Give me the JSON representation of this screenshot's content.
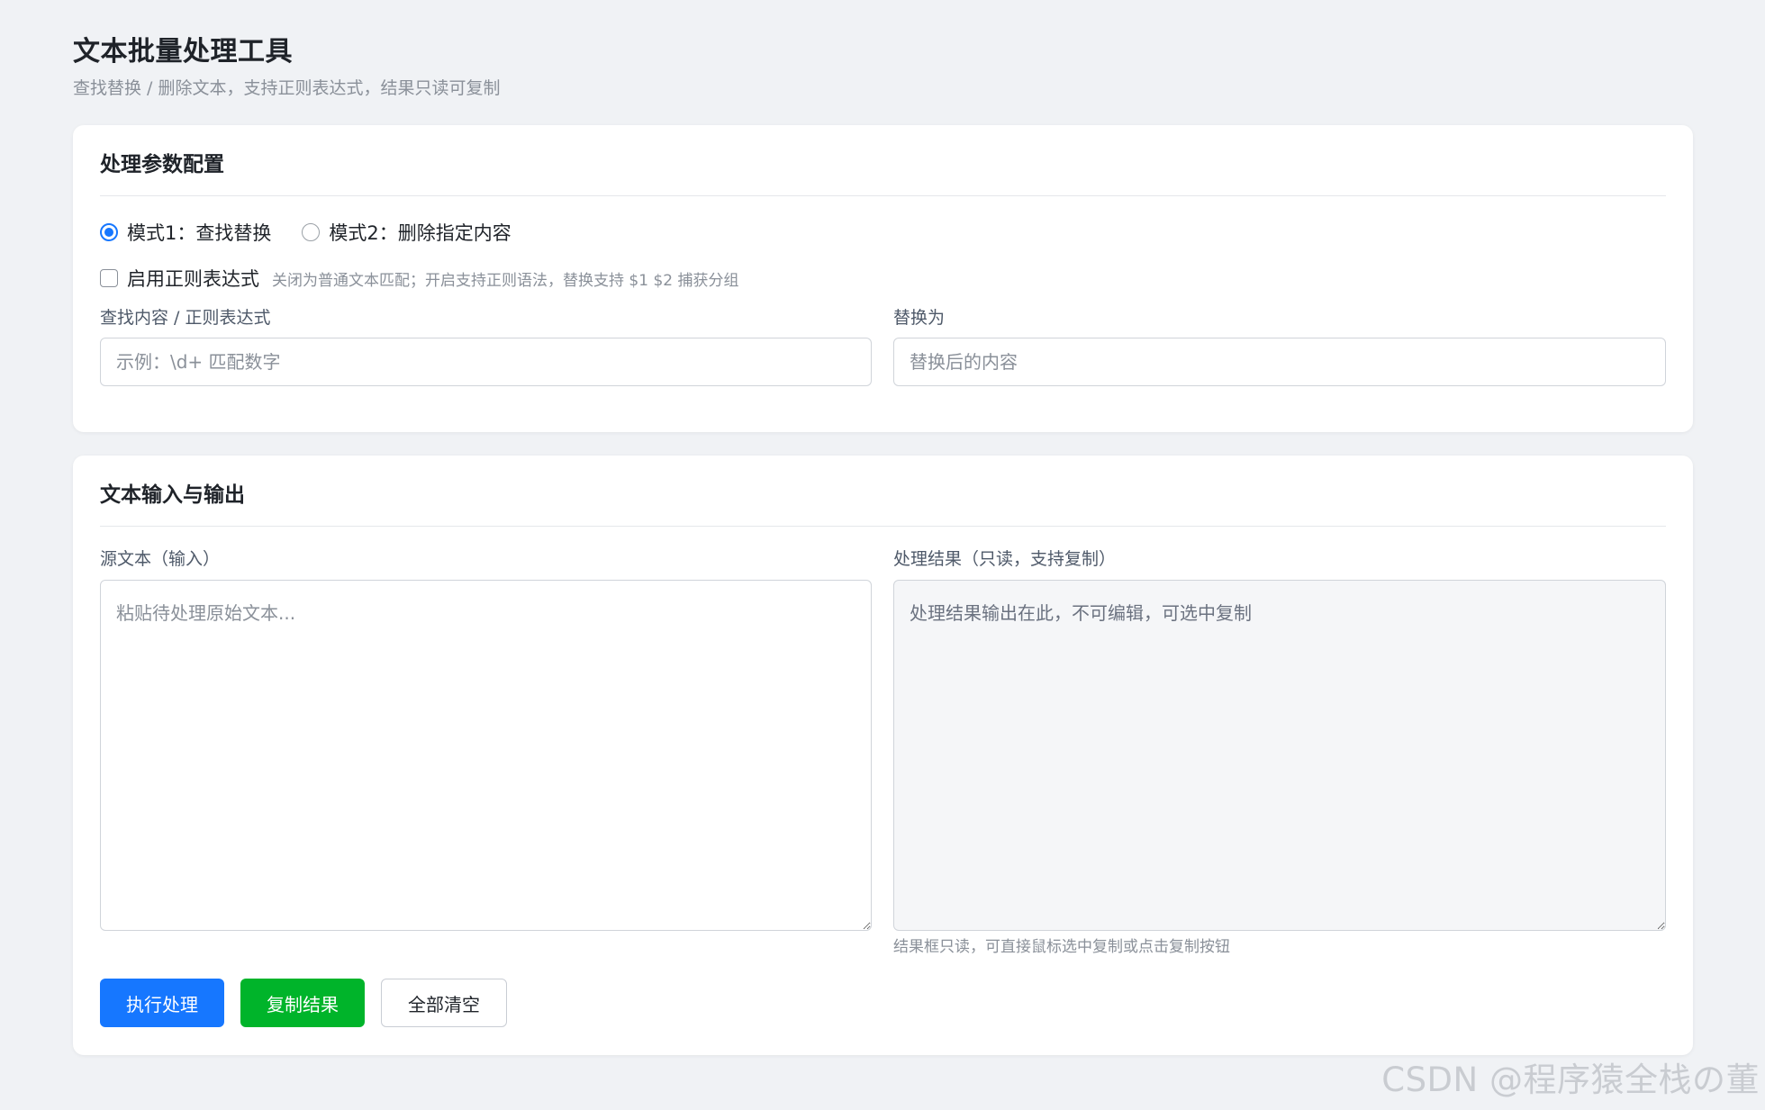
{
  "header": {
    "title": "文本批量处理工具",
    "subtitle": "查找替换 / 删除文本，支持正则表达式，结果只读可复制"
  },
  "config": {
    "title": "处理参数配置",
    "modes": [
      {
        "label": "模式1：查找替换",
        "checked": true
      },
      {
        "label": "模式2：删除指定内容",
        "checked": false
      }
    ],
    "regex": {
      "label": "启用正则表达式",
      "checked": false,
      "hint": "关闭为普通文本匹配；开启支持正则语法，替换支持 $1 $2 捕获分组"
    },
    "find": {
      "label": "查找内容 / 正则表达式",
      "placeholder": "示例：\\d+ 匹配数字"
    },
    "replace": {
      "label": "替换为",
      "placeholder": "替换后的内容"
    }
  },
  "io": {
    "title": "文本输入与输出",
    "source": {
      "label": "源文本（输入）",
      "placeholder": "粘贴待处理原始文本..."
    },
    "result": {
      "label": "处理结果（只读，支持复制）",
      "placeholder": "处理结果输出在此，不可编辑，可选中复制",
      "hint": "结果框只读，可直接鼠标选中复制或点击复制按钮"
    },
    "buttons": {
      "execute": "执行处理",
      "copy": "复制结果",
      "clear": "全部清空"
    }
  },
  "watermark": "CSDN @程序猿全栈の董",
  "colors": {
    "primary": "#1677ff",
    "success": "#00b42a",
    "background": "#f0f2f5"
  }
}
